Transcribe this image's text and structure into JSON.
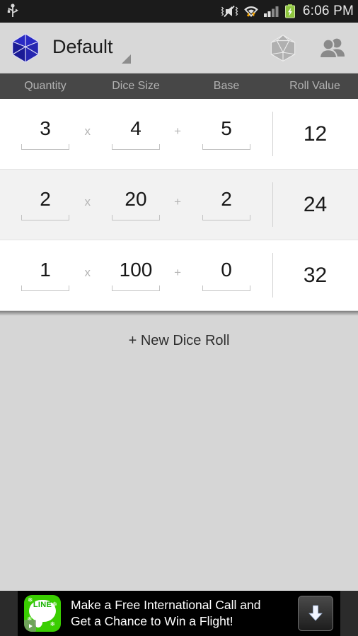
{
  "status_bar": {
    "time": "6:06 PM",
    "icons": [
      "usb-icon",
      "mute-vibrate-icon",
      "wifi-icon",
      "signal-icon",
      "battery-charging-icon"
    ]
  },
  "action_bar": {
    "app_icon": "blue-d20-icon",
    "title": "Default",
    "spinner_icon": "dropdown-triangle-icon",
    "roll_button_icon": "gray-d20-icon",
    "contacts_button_icon": "people-icon"
  },
  "table": {
    "headers": {
      "quantity": "Quantity",
      "dice_size": "Dice Size",
      "base": "Base",
      "roll_value": "Roll Value"
    },
    "operators": {
      "multiply": "x",
      "plus": "+"
    },
    "rows": [
      {
        "quantity": "3",
        "dice_size": "4",
        "base": "5",
        "roll_value": "12"
      },
      {
        "quantity": "2",
        "dice_size": "20",
        "base": "2",
        "roll_value": "24"
      },
      {
        "quantity": "1",
        "dice_size": "100",
        "base": "0",
        "roll_value": "32"
      }
    ]
  },
  "empty_area": {
    "new_roll_label": "+ New Dice Roll"
  },
  "ad": {
    "app_icon_label": "LINE",
    "line1": "Make a Free International Call and",
    "line2": "Get a Chance to Win a Flight!",
    "download_icon": "download-arrow-icon",
    "adchoices_icon": "adchoices-icon"
  },
  "colors": {
    "status_bar_bg": "#1b1b1b",
    "action_bar_bg": "#d8d8d8",
    "column_header_bg": "#474747",
    "row_bg": "#ffffff",
    "row_alt_bg": "#f2f2f2",
    "empty_bg": "#d6d6d6",
    "brand_blue": "#2222a8",
    "ad_green": "#3ace01",
    "battery_green": "#8ec63f"
  }
}
